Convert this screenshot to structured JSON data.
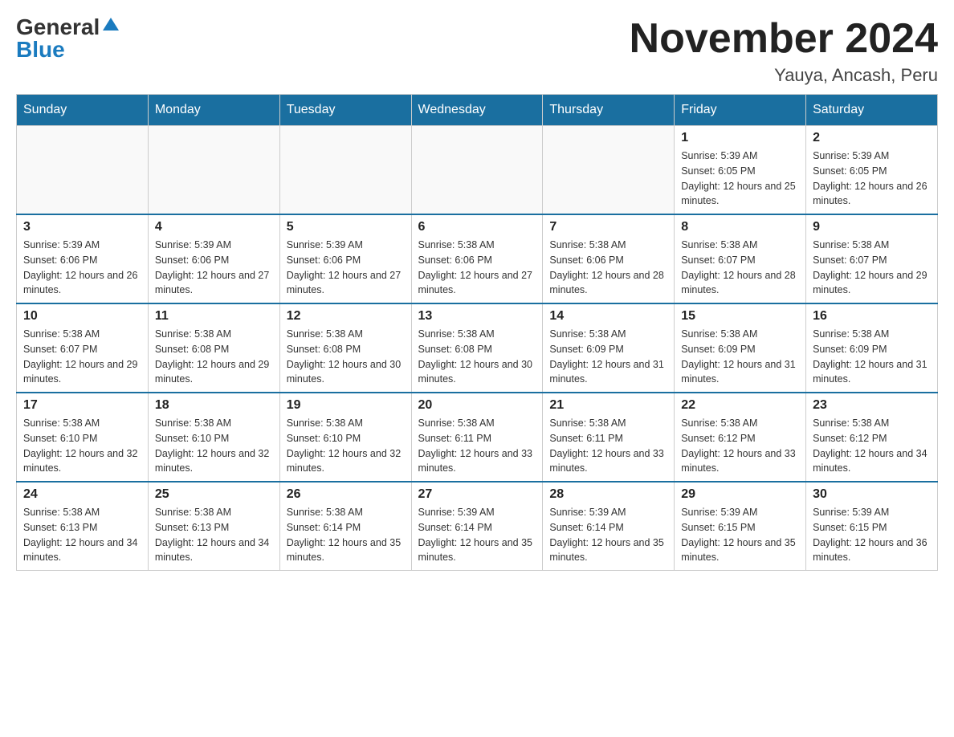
{
  "header": {
    "logo_general": "General",
    "logo_blue": "Blue",
    "title": "November 2024",
    "location": "Yauya, Ancash, Peru"
  },
  "weekdays": [
    "Sunday",
    "Monday",
    "Tuesday",
    "Wednesday",
    "Thursday",
    "Friday",
    "Saturday"
  ],
  "weeks": [
    [
      {
        "day": "",
        "sunrise": "",
        "sunset": "",
        "daylight": ""
      },
      {
        "day": "",
        "sunrise": "",
        "sunset": "",
        "daylight": ""
      },
      {
        "day": "",
        "sunrise": "",
        "sunset": "",
        "daylight": ""
      },
      {
        "day": "",
        "sunrise": "",
        "sunset": "",
        "daylight": ""
      },
      {
        "day": "",
        "sunrise": "",
        "sunset": "",
        "daylight": ""
      },
      {
        "day": "1",
        "sunrise": "Sunrise: 5:39 AM",
        "sunset": "Sunset: 6:05 PM",
        "daylight": "Daylight: 12 hours and 25 minutes."
      },
      {
        "day": "2",
        "sunrise": "Sunrise: 5:39 AM",
        "sunset": "Sunset: 6:05 PM",
        "daylight": "Daylight: 12 hours and 26 minutes."
      }
    ],
    [
      {
        "day": "3",
        "sunrise": "Sunrise: 5:39 AM",
        "sunset": "Sunset: 6:06 PM",
        "daylight": "Daylight: 12 hours and 26 minutes."
      },
      {
        "day": "4",
        "sunrise": "Sunrise: 5:39 AM",
        "sunset": "Sunset: 6:06 PM",
        "daylight": "Daylight: 12 hours and 27 minutes."
      },
      {
        "day": "5",
        "sunrise": "Sunrise: 5:39 AM",
        "sunset": "Sunset: 6:06 PM",
        "daylight": "Daylight: 12 hours and 27 minutes."
      },
      {
        "day": "6",
        "sunrise": "Sunrise: 5:38 AM",
        "sunset": "Sunset: 6:06 PM",
        "daylight": "Daylight: 12 hours and 27 minutes."
      },
      {
        "day": "7",
        "sunrise": "Sunrise: 5:38 AM",
        "sunset": "Sunset: 6:06 PM",
        "daylight": "Daylight: 12 hours and 28 minutes."
      },
      {
        "day": "8",
        "sunrise": "Sunrise: 5:38 AM",
        "sunset": "Sunset: 6:07 PM",
        "daylight": "Daylight: 12 hours and 28 minutes."
      },
      {
        "day": "9",
        "sunrise": "Sunrise: 5:38 AM",
        "sunset": "Sunset: 6:07 PM",
        "daylight": "Daylight: 12 hours and 29 minutes."
      }
    ],
    [
      {
        "day": "10",
        "sunrise": "Sunrise: 5:38 AM",
        "sunset": "Sunset: 6:07 PM",
        "daylight": "Daylight: 12 hours and 29 minutes."
      },
      {
        "day": "11",
        "sunrise": "Sunrise: 5:38 AM",
        "sunset": "Sunset: 6:08 PM",
        "daylight": "Daylight: 12 hours and 29 minutes."
      },
      {
        "day": "12",
        "sunrise": "Sunrise: 5:38 AM",
        "sunset": "Sunset: 6:08 PM",
        "daylight": "Daylight: 12 hours and 30 minutes."
      },
      {
        "day": "13",
        "sunrise": "Sunrise: 5:38 AM",
        "sunset": "Sunset: 6:08 PM",
        "daylight": "Daylight: 12 hours and 30 minutes."
      },
      {
        "day": "14",
        "sunrise": "Sunrise: 5:38 AM",
        "sunset": "Sunset: 6:09 PM",
        "daylight": "Daylight: 12 hours and 31 minutes."
      },
      {
        "day": "15",
        "sunrise": "Sunrise: 5:38 AM",
        "sunset": "Sunset: 6:09 PM",
        "daylight": "Daylight: 12 hours and 31 minutes."
      },
      {
        "day": "16",
        "sunrise": "Sunrise: 5:38 AM",
        "sunset": "Sunset: 6:09 PM",
        "daylight": "Daylight: 12 hours and 31 minutes."
      }
    ],
    [
      {
        "day": "17",
        "sunrise": "Sunrise: 5:38 AM",
        "sunset": "Sunset: 6:10 PM",
        "daylight": "Daylight: 12 hours and 32 minutes."
      },
      {
        "day": "18",
        "sunrise": "Sunrise: 5:38 AM",
        "sunset": "Sunset: 6:10 PM",
        "daylight": "Daylight: 12 hours and 32 minutes."
      },
      {
        "day": "19",
        "sunrise": "Sunrise: 5:38 AM",
        "sunset": "Sunset: 6:10 PM",
        "daylight": "Daylight: 12 hours and 32 minutes."
      },
      {
        "day": "20",
        "sunrise": "Sunrise: 5:38 AM",
        "sunset": "Sunset: 6:11 PM",
        "daylight": "Daylight: 12 hours and 33 minutes."
      },
      {
        "day": "21",
        "sunrise": "Sunrise: 5:38 AM",
        "sunset": "Sunset: 6:11 PM",
        "daylight": "Daylight: 12 hours and 33 minutes."
      },
      {
        "day": "22",
        "sunrise": "Sunrise: 5:38 AM",
        "sunset": "Sunset: 6:12 PM",
        "daylight": "Daylight: 12 hours and 33 minutes."
      },
      {
        "day": "23",
        "sunrise": "Sunrise: 5:38 AM",
        "sunset": "Sunset: 6:12 PM",
        "daylight": "Daylight: 12 hours and 34 minutes."
      }
    ],
    [
      {
        "day": "24",
        "sunrise": "Sunrise: 5:38 AM",
        "sunset": "Sunset: 6:13 PM",
        "daylight": "Daylight: 12 hours and 34 minutes."
      },
      {
        "day": "25",
        "sunrise": "Sunrise: 5:38 AM",
        "sunset": "Sunset: 6:13 PM",
        "daylight": "Daylight: 12 hours and 34 minutes."
      },
      {
        "day": "26",
        "sunrise": "Sunrise: 5:38 AM",
        "sunset": "Sunset: 6:14 PM",
        "daylight": "Daylight: 12 hours and 35 minutes."
      },
      {
        "day": "27",
        "sunrise": "Sunrise: 5:39 AM",
        "sunset": "Sunset: 6:14 PM",
        "daylight": "Daylight: 12 hours and 35 minutes."
      },
      {
        "day": "28",
        "sunrise": "Sunrise: 5:39 AM",
        "sunset": "Sunset: 6:14 PM",
        "daylight": "Daylight: 12 hours and 35 minutes."
      },
      {
        "day": "29",
        "sunrise": "Sunrise: 5:39 AM",
        "sunset": "Sunset: 6:15 PM",
        "daylight": "Daylight: 12 hours and 35 minutes."
      },
      {
        "day": "30",
        "sunrise": "Sunrise: 5:39 AM",
        "sunset": "Sunset: 6:15 PM",
        "daylight": "Daylight: 12 hours and 36 minutes."
      }
    ]
  ]
}
